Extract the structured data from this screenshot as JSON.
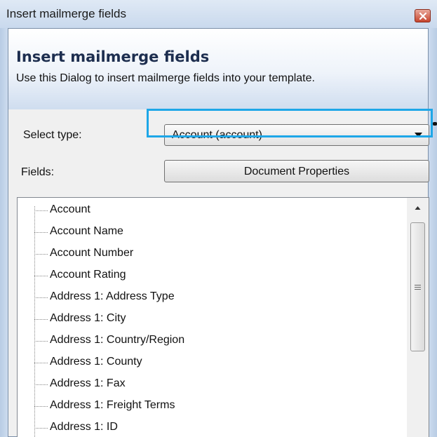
{
  "window": {
    "title": "Insert mailmerge fields"
  },
  "banner": {
    "title": "Insert mailmerge fields",
    "description": "Use this Dialog to insert mailmerge fields into your template."
  },
  "form": {
    "select_type_label": "Select type:",
    "select_type_value": "Account (account)",
    "fields_label": "Fields:",
    "document_properties_button": "Document Properties"
  },
  "fields": [
    "Account",
    "Account Name",
    "Account Number",
    "Account Rating",
    "Address 1: Address Type",
    "Address 1: City",
    "Address 1: Country/Region",
    "Address 1: County",
    "Address 1: Fax",
    "Address 1: Freight Terms",
    "Address 1: ID"
  ],
  "colors": {
    "highlight": "#1ea7e8",
    "close_button": "#c7452e"
  },
  "icons": [
    "close-icon",
    "dropdown-arrow-icon",
    "scroll-up-arrow-icon"
  ]
}
